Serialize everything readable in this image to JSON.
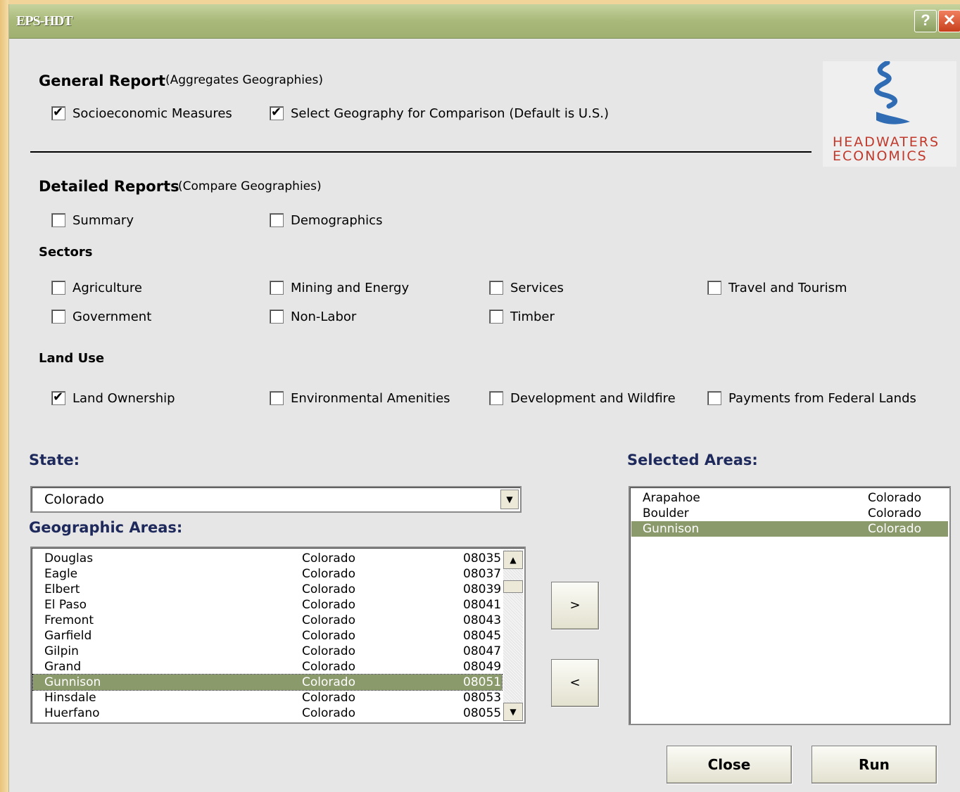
{
  "window": {
    "title": "EPS-HDT",
    "help_glyph": "?",
    "close_glyph": "✕"
  },
  "logo": {
    "line1": "HEADWATERS",
    "line2": "ECONOMICS",
    "icon": "stream-swirl-icon",
    "color": "#c0392b"
  },
  "general": {
    "title": "General Report",
    "note": "(Aggregates Geographies)",
    "options": [
      {
        "label": "Socioeconomic Measures",
        "checked": true
      },
      {
        "label": "Select Geography for Comparison (Default is U.S.)",
        "checked": true
      }
    ]
  },
  "detailed": {
    "title": "Detailed Reports",
    "note": "(Compare Geographies)",
    "options": [
      {
        "label": "Summary",
        "checked": false
      },
      {
        "label": "Demographics",
        "checked": false
      }
    ]
  },
  "sectors": {
    "title": "Sectors",
    "options": [
      {
        "label": "Agriculture",
        "checked": false
      },
      {
        "label": "Mining and Energy",
        "checked": false
      },
      {
        "label": "Services",
        "checked": false
      },
      {
        "label": "Travel and Tourism",
        "checked": false
      },
      {
        "label": "Government",
        "checked": false
      },
      {
        "label": "Non-Labor",
        "checked": false
      },
      {
        "label": "Timber",
        "checked": false
      }
    ]
  },
  "landuse": {
    "title": "Land Use",
    "options": [
      {
        "label": "Land Ownership",
        "checked": true
      },
      {
        "label": "Environmental Amenities",
        "checked": false
      },
      {
        "label": "Development and Wildfire",
        "checked": false
      },
      {
        "label": "Payments from Federal Lands",
        "checked": false
      }
    ]
  },
  "state": {
    "label": "State:",
    "value": "Colorado"
  },
  "geographic": {
    "label": "Geographic Areas:",
    "rows": [
      {
        "name": "Douglas",
        "state": "Colorado",
        "code": "08035"
      },
      {
        "name": "Eagle",
        "state": "Colorado",
        "code": "08037"
      },
      {
        "name": "Elbert",
        "state": "Colorado",
        "code": "08039"
      },
      {
        "name": "El Paso",
        "state": "Colorado",
        "code": "08041"
      },
      {
        "name": "Fremont",
        "state": "Colorado",
        "code": "08043"
      },
      {
        "name": "Garfield",
        "state": "Colorado",
        "code": "08045"
      },
      {
        "name": "Gilpin",
        "state": "Colorado",
        "code": "08047"
      },
      {
        "name": "Grand",
        "state": "Colorado",
        "code": "08049"
      },
      {
        "name": "Gunnison",
        "state": "Colorado",
        "code": "08051",
        "selected": true
      },
      {
        "name": "Hinsdale",
        "state": "Colorado",
        "code": "08053"
      },
      {
        "name": "Huerfano",
        "state": "Colorado",
        "code": "08055"
      }
    ]
  },
  "selected_areas": {
    "label": "Selected Areas:",
    "rows": [
      {
        "name": "Arapahoe",
        "state": "Colorado"
      },
      {
        "name": "Boulder",
        "state": "Colorado"
      },
      {
        "name": "Gunnison",
        "state": "Colorado",
        "selected": true
      }
    ]
  },
  "buttons": {
    "add": ">",
    "remove": "<",
    "close": "Close",
    "run": "Run"
  },
  "colors": {
    "highlight": "#8a9a6b",
    "label_blue": "#1f2a5c",
    "titlebar": "#a8b97a"
  }
}
